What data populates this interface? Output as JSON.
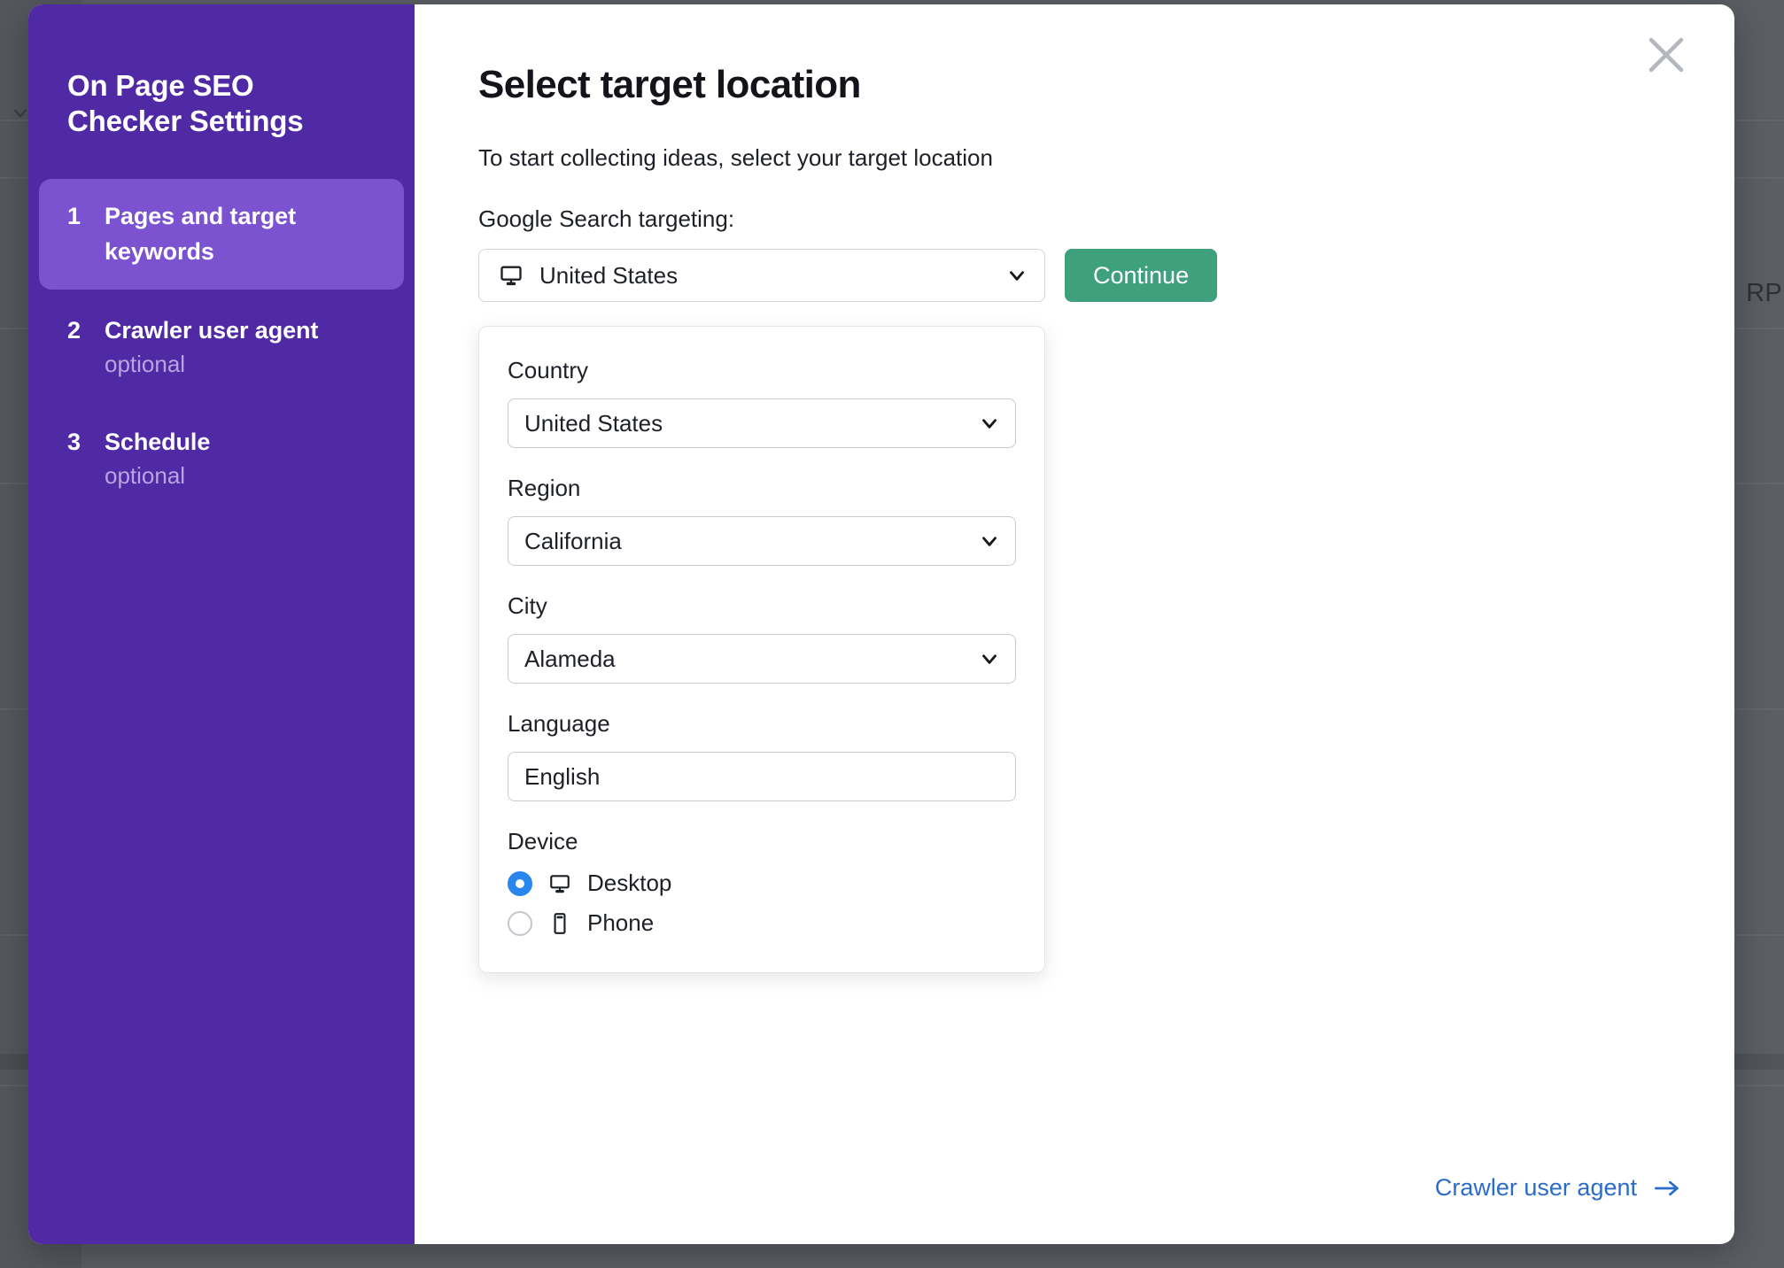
{
  "backdrop": {
    "behind_text": "RP",
    "chevron_icon": "chevron-down-icon"
  },
  "modal": {
    "close_icon": "close-icon"
  },
  "sidebar": {
    "title": "On Page SEO Checker Settings",
    "items": [
      {
        "number": "1",
        "label": "Pages and target keywords",
        "optional": "",
        "active": true
      },
      {
        "number": "2",
        "label": "Crawler user agent",
        "optional": "optional",
        "active": false
      },
      {
        "number": "3",
        "label": "Schedule",
        "optional": "optional",
        "active": false
      }
    ]
  },
  "main": {
    "title": "Select target location",
    "intro": "To start collecting ideas, select your target location",
    "targeting_label": "Google Search targeting:",
    "location_select": {
      "value": "United States",
      "icon": "monitor-icon",
      "chevron": "chevron-down-icon"
    },
    "continue_label": "Continue"
  },
  "dropdown": {
    "country": {
      "label": "Country",
      "value": "United States"
    },
    "region": {
      "label": "Region",
      "value": "California"
    },
    "city": {
      "label": "City",
      "value": "Alameda"
    },
    "language": {
      "label": "Language",
      "value": "English"
    },
    "device": {
      "label": "Device",
      "options": [
        {
          "label": "Desktop",
          "icon": "monitor-icon",
          "selected": true
        },
        {
          "label": "Phone",
          "icon": "phone-icon",
          "selected": false
        }
      ]
    }
  },
  "footer": {
    "next_link": "Crawler user agent",
    "arrow_icon": "arrow-right-icon"
  },
  "colors": {
    "sidebar_bg": "#5029a5",
    "sidebar_active": "#7b52d0",
    "continue_green": "#3fa07e",
    "link_blue": "#2b6ccb",
    "radio_blue": "#2a86ef"
  }
}
